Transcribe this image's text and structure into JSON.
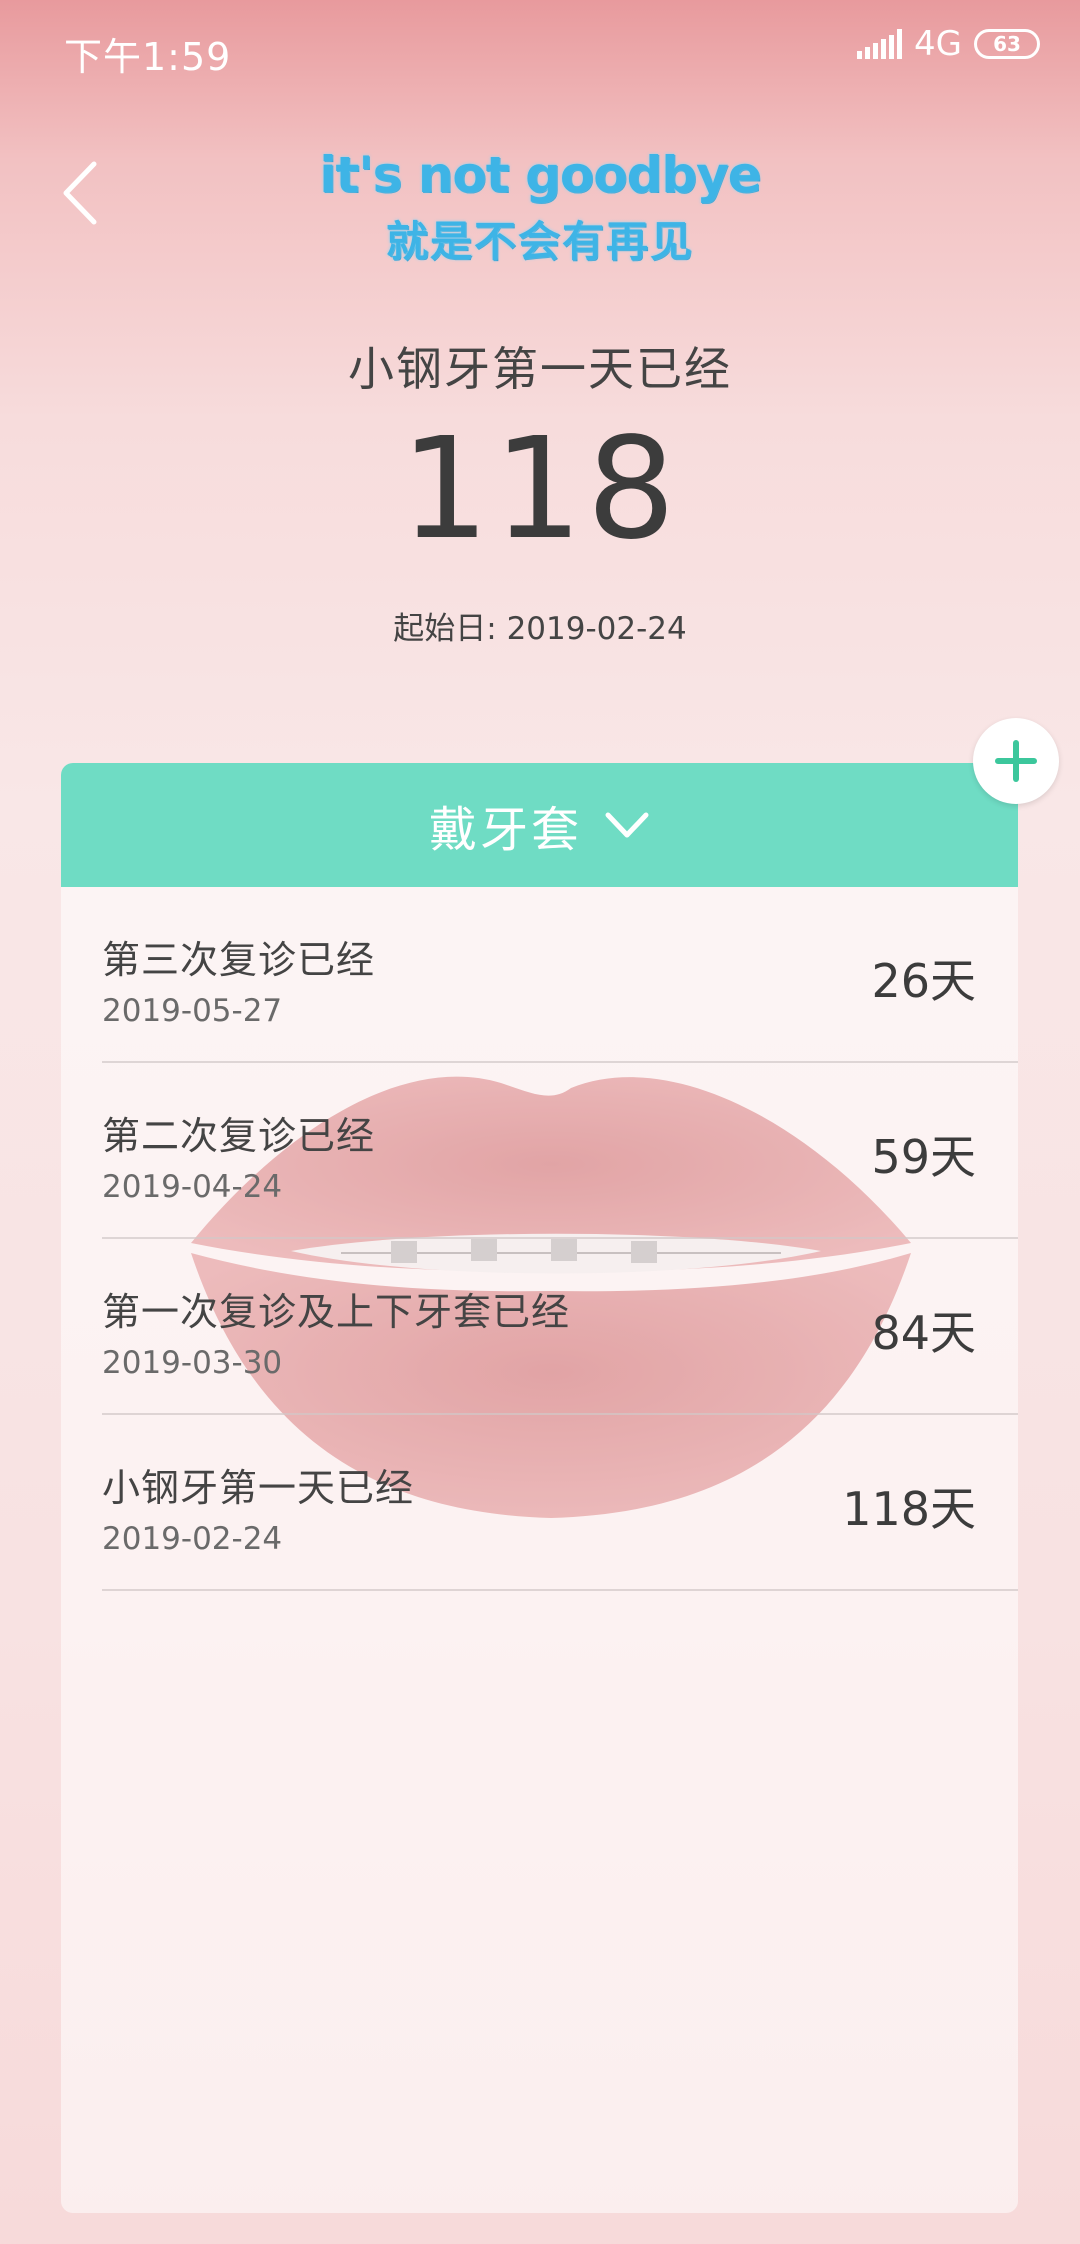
{
  "status_bar": {
    "time": "下午1:59",
    "network": "4G",
    "battery": "63"
  },
  "banner": {
    "english": "it's not goodbye",
    "chinese": "就是不会有再见"
  },
  "hero": {
    "label": "小钢牙第一天已经",
    "count": "118",
    "start_date": "起始日: 2019-02-24"
  },
  "category": {
    "title": "戴牙套"
  },
  "events": [
    {
      "title": "第三次复诊已经",
      "date": "2019-05-27",
      "days": "26天"
    },
    {
      "title": "第二次复诊已经",
      "date": "2019-04-24",
      "days": "59天"
    },
    {
      "title": "第一次复诊及上下牙套已经",
      "date": "2019-03-30",
      "days": "84天"
    },
    {
      "title": "小钢牙第一天已经",
      "date": "2019-02-24",
      "days": "118天"
    }
  ],
  "colors": {
    "accent_teal": "#6fdcc4",
    "banner_blue": "#3eb4e6",
    "fab_plus": "#3cc79c"
  },
  "icons": {
    "back": "back-arrow-icon",
    "dropdown": "chevron-down-icon",
    "add": "plus-icon",
    "signal": "signal-icon",
    "battery": "battery-icon"
  }
}
